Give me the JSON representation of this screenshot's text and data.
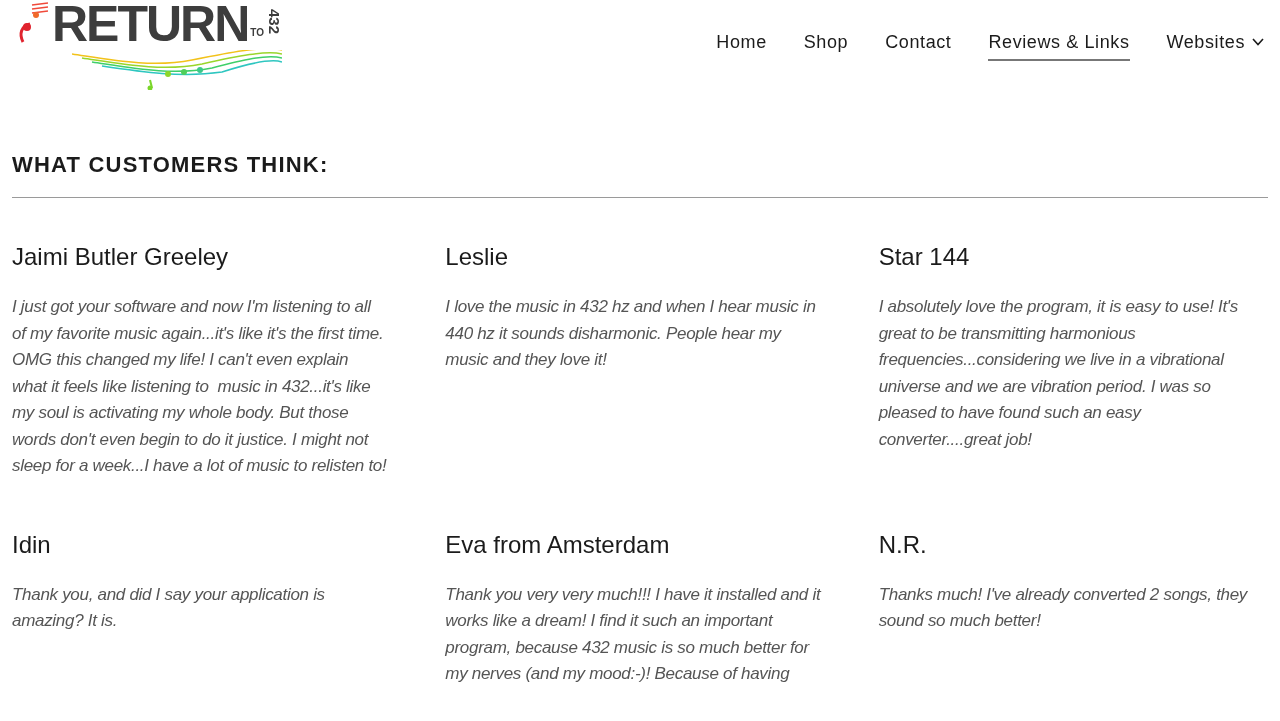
{
  "logo": {
    "word": "RETURN",
    "small_word": "TO",
    "number": "432"
  },
  "nav": [
    {
      "label": "Home",
      "selected": false,
      "kind": "link"
    },
    {
      "label": "Shop",
      "selected": false,
      "kind": "link"
    },
    {
      "label": "Contact",
      "selected": false,
      "kind": "link"
    },
    {
      "label": "Reviews & Links",
      "selected": true,
      "kind": "link"
    },
    {
      "label": "Websites",
      "selected": false,
      "kind": "dropdown"
    }
  ],
  "section": {
    "heading": "WHAT CUSTOMERS THINK:"
  },
  "reviews": [
    {
      "name": "Jaimi Butler Greeley",
      "text": "I just got your software and now I'm listening to all of my favorite music again...it's like it's the first time.  OMG this changed my life! I can't even explain what it feels like listening to  music in 432...it's like my soul is activating my whole body. But those words don't even begin to do it justice. I might not sleep for a week...I have a lot of music to relisten to!"
    },
    {
      "name": "Leslie",
      "text": "I love the music in 432 hz and when I hear music in 440 hz it sounds disharmonic. People hear my music and they love it!"
    },
    {
      "name": "Star 144",
      "text": "I absolutely love the program, it is easy to use! It's great to be transmitting harmonious frequencies...considering we live in a vibrational universe and we are vibration period. I was so pleased to have found such an easy converter....great job!"
    },
    {
      "name": "Idin",
      "text": "Thank you, and did I say your application is amazing? It is."
    },
    {
      "name": "Eva from Amsterdam",
      "text": "Thank you very very much!!! I have it installed and it works like a dream! I find it such an important program, because 432 music is so much better for my nerves (and my mood:-)! Because of having"
    },
    {
      "name": "N.R.",
      "text": "Thanks much! I've already converted 2 songs, they sound so much better!"
    }
  ]
}
